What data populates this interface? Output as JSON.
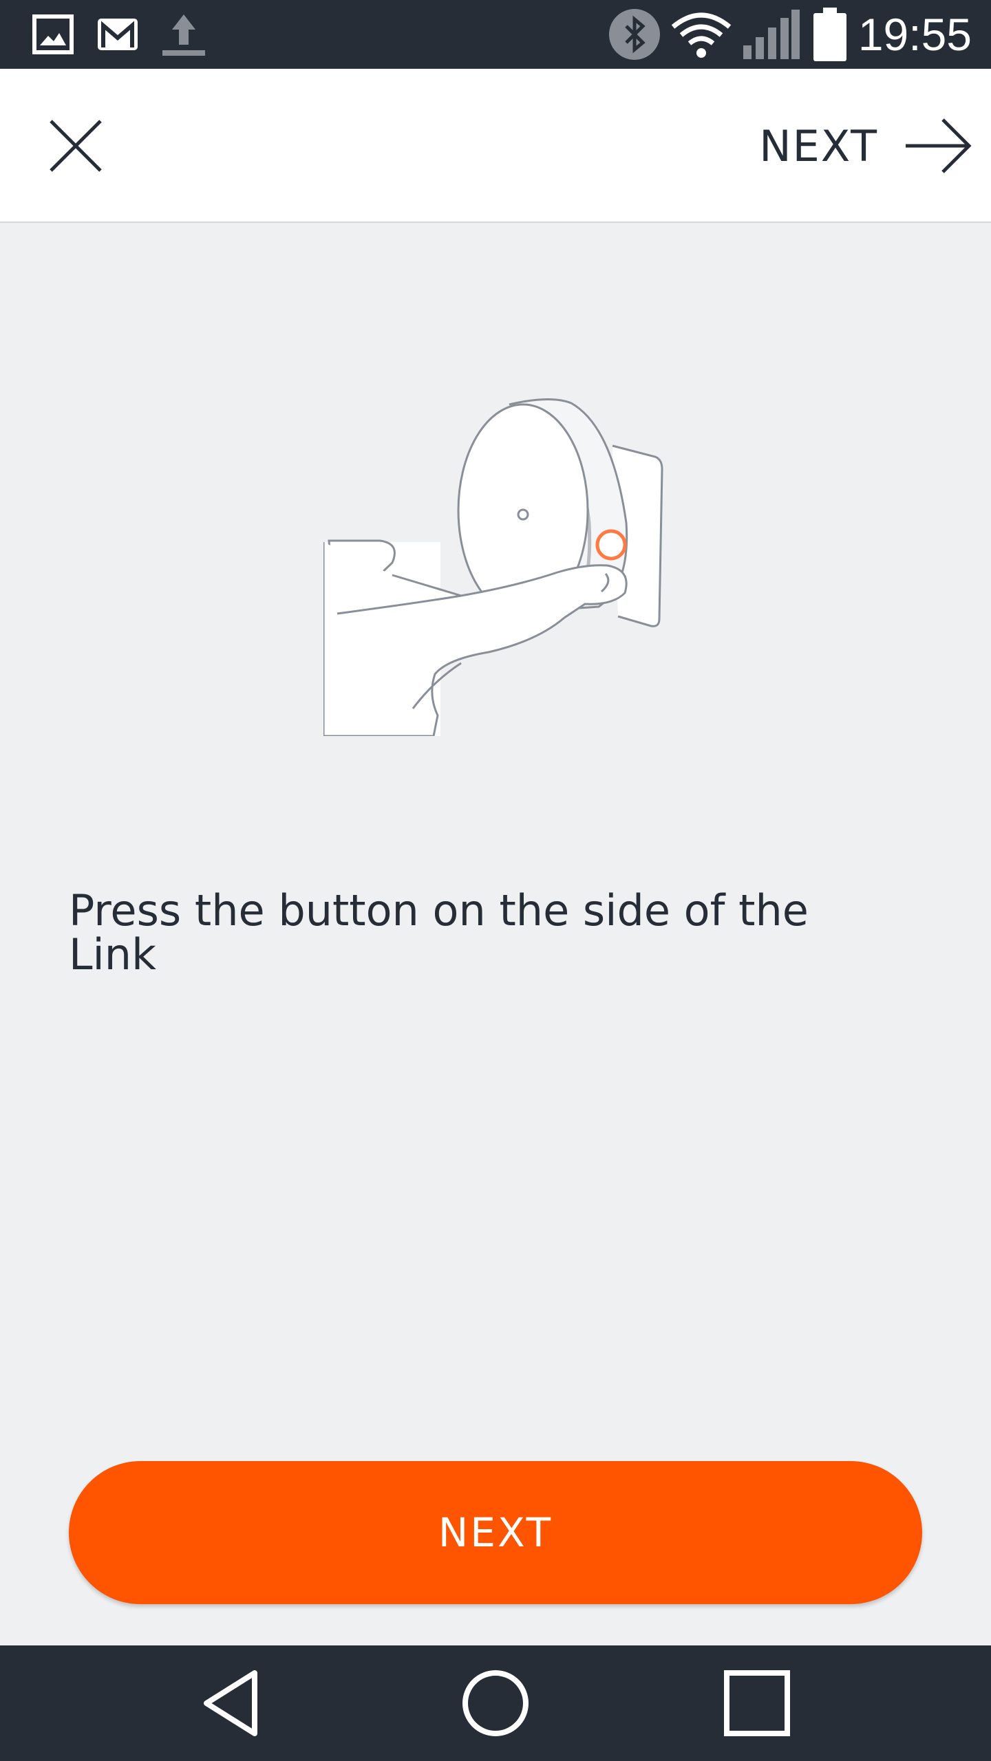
{
  "status_bar": {
    "time": "19:55",
    "left_icons": [
      "gallery-icon",
      "gmail-icon",
      "upload-icon"
    ],
    "right_icons": [
      "bluetooth-icon",
      "wifi-icon",
      "signal-icon",
      "battery-icon"
    ]
  },
  "app_bar": {
    "close_icon": "close-icon",
    "next_label": "NEXT",
    "next_icon": "arrow-right-icon"
  },
  "main": {
    "illustration": "hand-pressing-link-button-illustration",
    "instruction": "Press the button on the side of the Link"
  },
  "footer": {
    "next_label": "NEXT"
  },
  "nav_bar": {
    "icons": [
      "back-icon",
      "home-icon",
      "recents-icon"
    ]
  },
  "colors": {
    "accent": "#ff5500",
    "status_bar_bg": "#272d36",
    "page_bg": "#eff0f2",
    "text": "#272d36"
  }
}
